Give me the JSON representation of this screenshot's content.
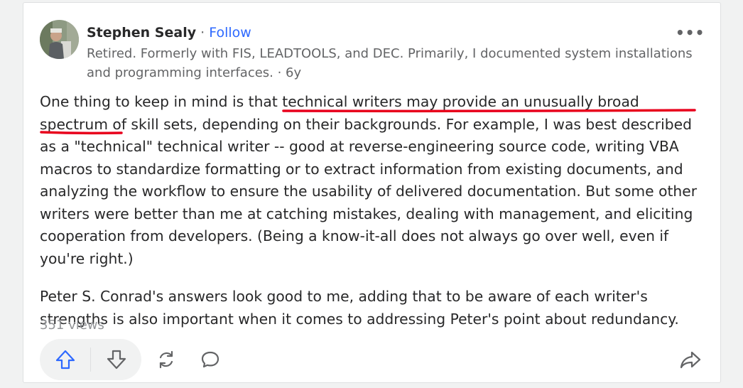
{
  "post": {
    "author": "Stephen Sealy",
    "separator": "·",
    "follow_label": "Follow",
    "credential": "Retired. Formerly with FIS, LEADTOOLS, and DEC. Primarily, I documented system installations and programming interfaces. · 6y",
    "more_label": "•••",
    "paragraph1": {
      "before": "One thing to keep in mind is that ",
      "highlight": "technical writers may provide an unusually broad spectrum of skill sets,",
      "after": " depending on their backgrounds. For example, I was best described as a \"technical\" technical writer -- good at reverse-engineering source code, writing VBA macros to standardize formatting or to extract information from existing documents, and analyzing the workflow to ensure the usability of delivered documentation. But some other writers were better than me at catching mistakes, dealing with management, and eliciting cooperation from developers. (Being a know-it-all does not always go over well, even if you're right.)"
    },
    "paragraph2": "Peter S. Conrad's answers look good to me, adding that to be aware of each writer's strengths is also important when it comes to addressing Peter's point about redundancy.",
    "views": "351 views"
  },
  "actions": {
    "upvote_icon": "upvote-arrow-icon",
    "downvote_icon": "downvote-arrow-icon",
    "share_icon": "share-arrow-icon",
    "comment_icon": "comment-bubble-icon",
    "reshare_icon": "reshare-cycle-icon"
  },
  "colors": {
    "accent": "#2e69ff",
    "annotation": "#e8001c",
    "text": "#282829",
    "muted": "#636466"
  }
}
